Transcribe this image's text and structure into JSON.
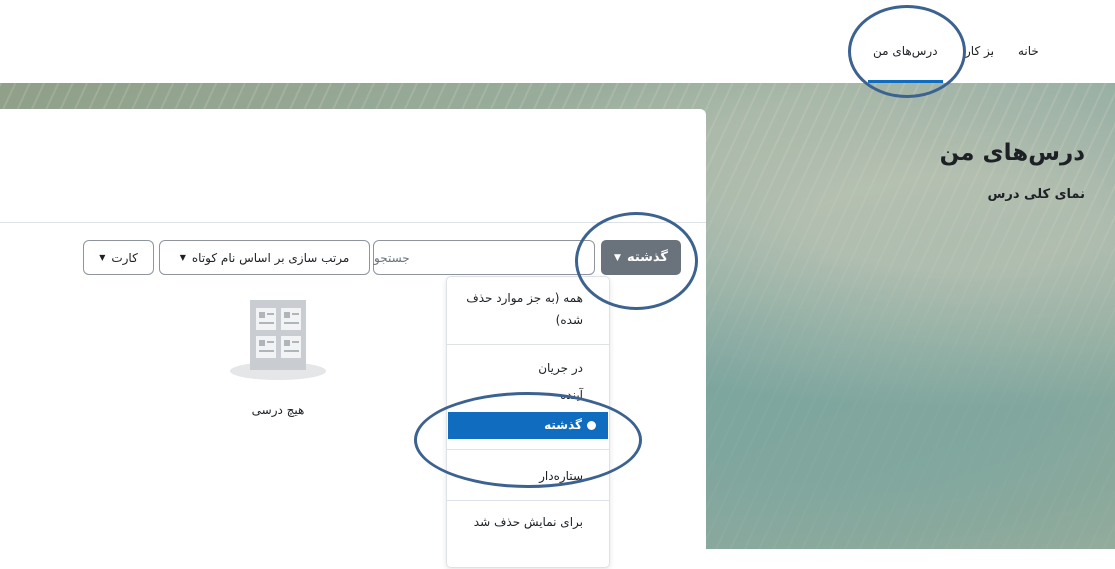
{
  "nav": {
    "home": "خانه",
    "dashboard": "میز کار",
    "my_courses": "درس‌های من"
  },
  "page": {
    "title": "درس‌های من",
    "section": "نمای کلی درس"
  },
  "controls": {
    "filter_label": "گذشته",
    "search_placeholder": "جستجو",
    "sort_label": "مرتب سازی بر اساس نام کوتاه",
    "view_label": "کارت"
  },
  "empty_state": {
    "text": "هیچ درسی"
  },
  "filter_menu": {
    "items": [
      {
        "label": "همه (به جز موارد حذف شده)"
      },
      {
        "label": "در جریان"
      },
      {
        "label": "آینده"
      },
      {
        "label": "گذشته",
        "selected": true
      },
      {
        "label": "ستاره‌دار"
      },
      {
        "label": "برای نمایش حذف شد"
      }
    ]
  },
  "colors": {
    "accent": "#0f6cbf",
    "filter_button": "#6a737b",
    "annotation": "#3c6290"
  }
}
